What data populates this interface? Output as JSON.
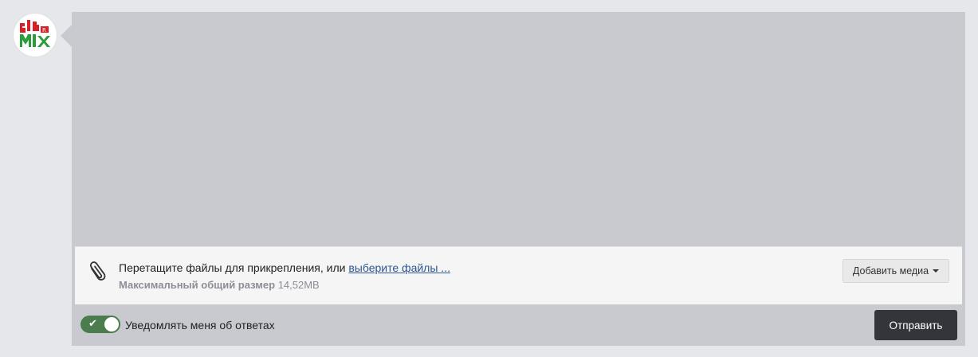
{
  "attachments": {
    "drop_text": "Перетащите файлы для прикрепления, или ",
    "choose_link": "выберите файлы ...",
    "max_size_label": "Максимальный общий размер",
    "max_size_value": "14,52MB",
    "add_media_label": "Добавить медиа"
  },
  "notify": {
    "label": "Уведомлять меня об ответах",
    "enabled": true
  },
  "submit": {
    "label": "Отправить"
  },
  "colors": {
    "editor_bg": "#c9cacf",
    "toggle_on": "#4a7c4e",
    "submit_bg": "#33353a",
    "link": "#2c5694"
  },
  "icons": {
    "attach": "paperclip-icon",
    "toggle": "check-icon",
    "dropdown": "caret-down-icon"
  }
}
